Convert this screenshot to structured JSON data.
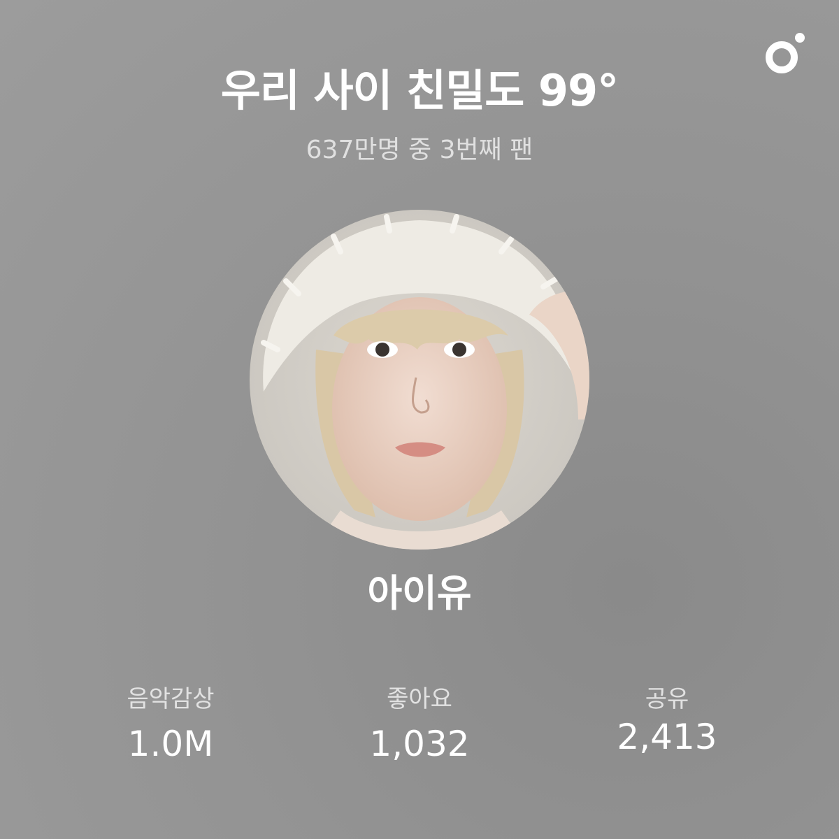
{
  "header": {
    "title": "우리 사이 친밀도 99°",
    "subtitle": "637만명 중 3번째 팬"
  },
  "brand": {
    "icon": "app-logo-icon"
  },
  "artist": {
    "name": "아이유",
    "photo": "artist-profile-photo"
  },
  "stats": [
    {
      "label": "음악감상",
      "value": "1.0M"
    },
    {
      "label": "좋아요",
      "value": "1,032"
    },
    {
      "label": "공유",
      "value": "2,413"
    }
  ],
  "colors": {
    "background": "#939393",
    "text_primary": "#ffffff",
    "text_secondary": "#e0e0e0"
  }
}
